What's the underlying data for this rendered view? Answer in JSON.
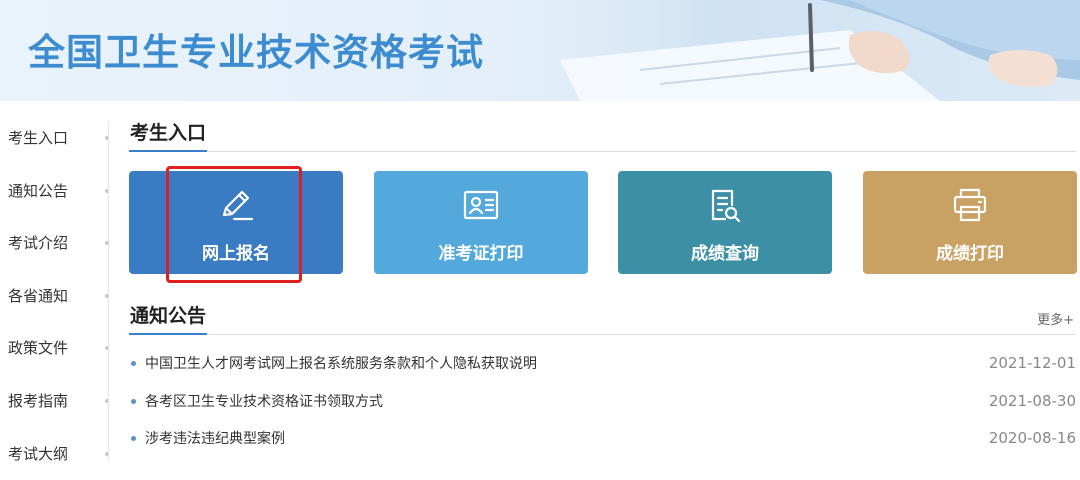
{
  "banner": {
    "title": "全国卫生专业技术资格考试"
  },
  "sidebar": {
    "items": [
      {
        "label": "考生入口"
      },
      {
        "label": "通知公告"
      },
      {
        "label": "考试介绍"
      },
      {
        "label": "各省通知"
      },
      {
        "label": "政策文件"
      },
      {
        "label": "报考指南"
      },
      {
        "label": "考试大纲"
      }
    ]
  },
  "entry": {
    "title": "考生入口",
    "tiles": [
      {
        "label": "网上报名",
        "icon": "pencil-icon",
        "color": "#3a7cc3"
      },
      {
        "label": "准考证打印",
        "icon": "id-card-icon",
        "color": "#54a9dc"
      },
      {
        "label": "成绩查询",
        "icon": "document-search-icon",
        "color": "#3d8fa6"
      },
      {
        "label": "成绩打印",
        "icon": "printer-icon",
        "color": "#c9a162"
      }
    ]
  },
  "notices": {
    "title": "通知公告",
    "more": "更多+",
    "items": [
      {
        "title": "中国卫生人才网考试网上报名系统服务条款和个人隐私获取说明",
        "date": "2021-12-01"
      },
      {
        "title": "各考区卫生专业技术资格证书领取方式",
        "date": "2021-08-30"
      },
      {
        "title": "涉考违法违纪典型案例",
        "date": "2020-08-16"
      }
    ]
  },
  "colors": {
    "accent": "#3a7fc8",
    "highlight": "#e02020"
  }
}
